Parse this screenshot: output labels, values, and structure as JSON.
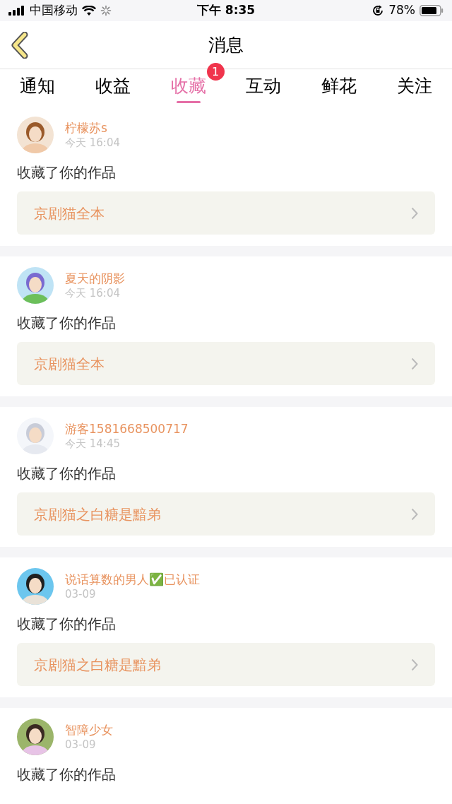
{
  "status_bar": {
    "carrier": "中国移动",
    "time": "下午 8:35",
    "battery": "78%"
  },
  "nav": {
    "title": "消息"
  },
  "tabs": [
    {
      "label": "通知",
      "selected": false
    },
    {
      "label": "收益",
      "selected": false
    },
    {
      "label": "收藏",
      "selected": true,
      "badge": "1"
    },
    {
      "label": "互动",
      "selected": false
    },
    {
      "label": "鲜花",
      "selected": false
    },
    {
      "label": "关注",
      "selected": false
    }
  ],
  "messages": [
    {
      "user": "柠檬苏s",
      "time": "今天 16:04",
      "text": "收藏了你的作品",
      "work": "京剧猫全本"
    },
    {
      "user": "夏天的阴影",
      "time": "今天 16:04",
      "text": "收藏了你的作品",
      "work": "京剧猫全本"
    },
    {
      "user": "游客1581668500717",
      "time": "今天 14:45",
      "text": "收藏了你的作品",
      "work": "京剧猫之白糖是黯弟"
    },
    {
      "user": "说话算数的男人✅已认证",
      "time": "03-09",
      "text": "收藏了你的作品",
      "work": "京剧猫之白糖是黯弟"
    },
    {
      "user": "智障少女",
      "time": "03-09",
      "text": "收藏了你的作品"
    }
  ]
}
